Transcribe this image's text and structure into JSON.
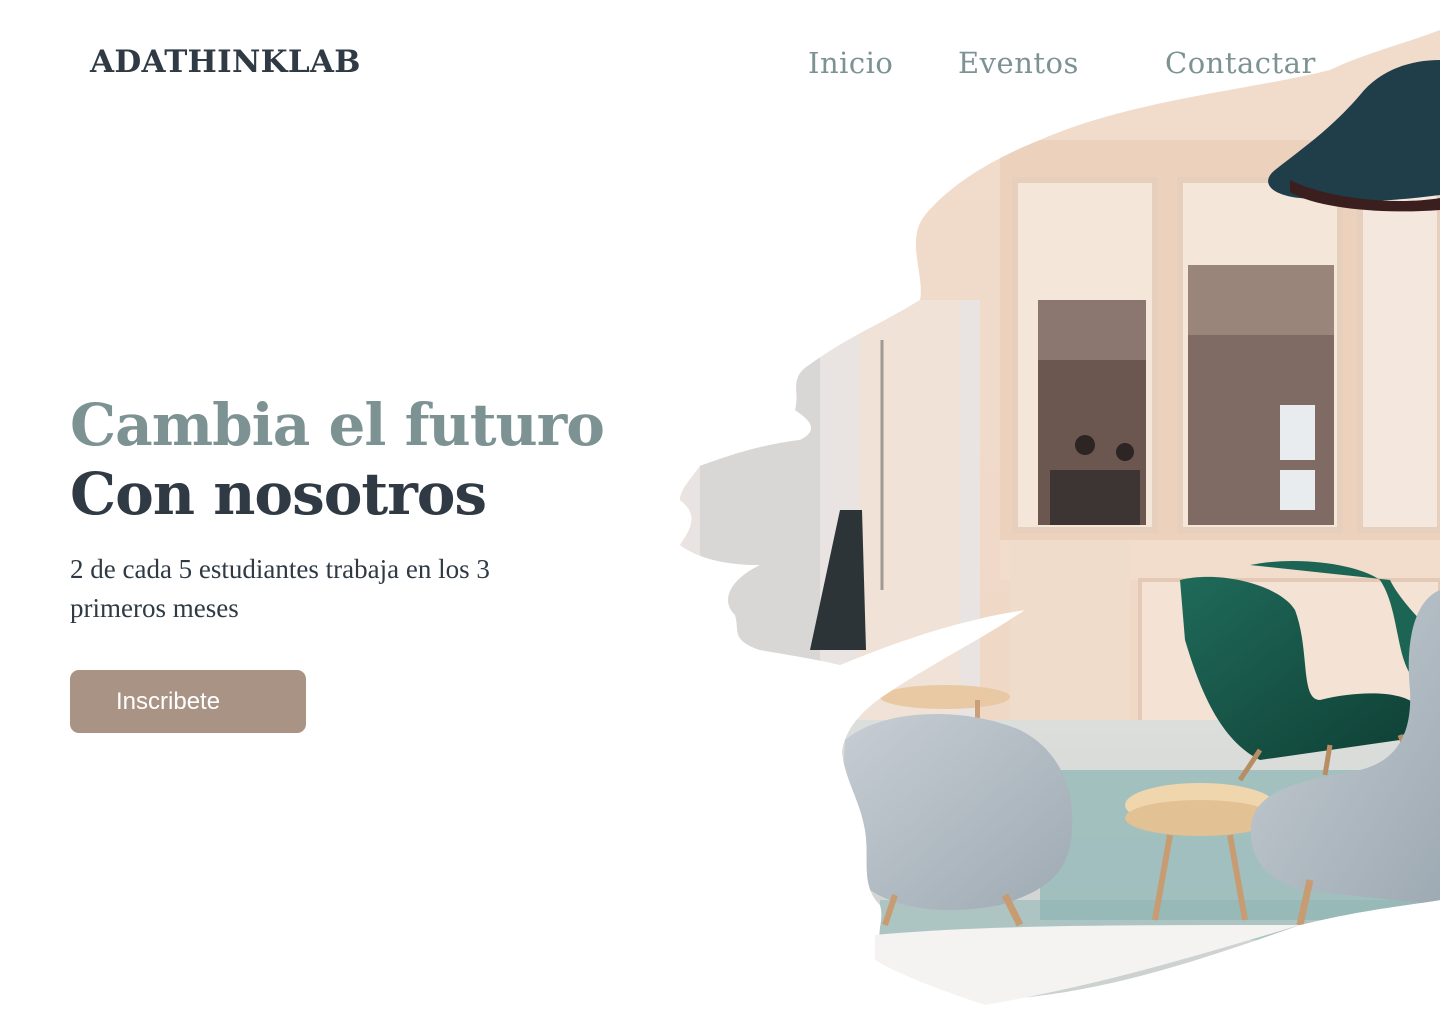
{
  "header": {
    "brand": "ADATHINKLAB",
    "nav": [
      {
        "label": "Inicio"
      },
      {
        "label": "Eventos"
      },
      {
        "label": "Contactar"
      }
    ]
  },
  "hero": {
    "headline_line1": "Cambia el futuro",
    "headline_line2": "Con nosotros",
    "subtitle": "2 de cada 5 estudiantes trabaja en los 3 primeros meses",
    "cta_label": "Inscribete"
  },
  "colors": {
    "primary_dark": "#2f3a44",
    "accent_teal_grey": "#7d9293",
    "cta_background": "#a99385",
    "chair_green": "#1b5c4e",
    "chair_grey": "#b9c2c9"
  },
  "image": {
    "icon": "office-lounge-photo"
  }
}
